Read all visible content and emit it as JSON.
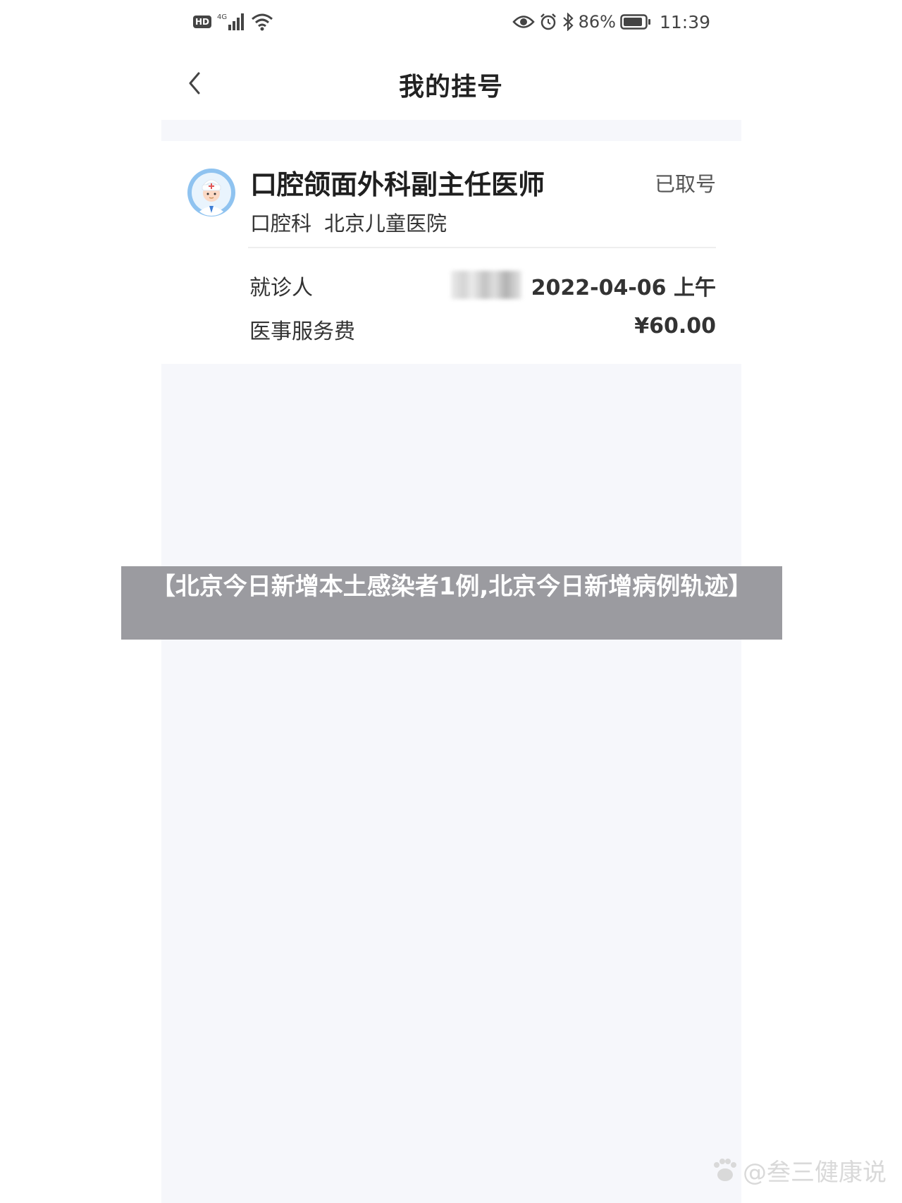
{
  "status_bar": {
    "hd_label": "HD",
    "network_label": "4G",
    "battery_percent": "86%",
    "time": "11:39",
    "icons": [
      "signal-icon",
      "wifi-icon",
      "eye-icon",
      "alarm-icon",
      "bluetooth-icon",
      "battery-icon"
    ]
  },
  "nav": {
    "title": "我的挂号",
    "back_icon": "chevron-left-icon"
  },
  "appointment": {
    "doctor_title": "口腔颌面外科副主任医师",
    "status": "已取号",
    "department": "口腔科",
    "hospital": "北京儿童医院",
    "patient_label": "就诊人",
    "patient_datetime": "2022-04-06  上午",
    "fee_label": "医事服务费",
    "fee_value": "¥60.00"
  },
  "overlay": {
    "banner_text": "【北京今日新增本土感染者1例,北京今日新增病例轨迹】"
  },
  "watermark": {
    "text": "@叁三健康说"
  },
  "colors": {
    "content_background": "#f6f7fb",
    "card_background": "#ffffff",
    "banner_background": "#96969b",
    "avatar_ring": "#8fc3f0"
  }
}
